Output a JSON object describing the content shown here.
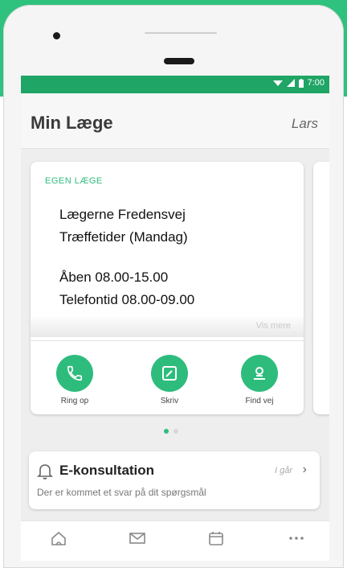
{
  "status_bar": {
    "time": "7:00"
  },
  "header": {
    "title": "Min Læge",
    "user": "Lars"
  },
  "doctor_card": {
    "label": "EGEN LÆGE",
    "clinic": "Lægerne Fredensvej",
    "hours_title": "Træffetider (Mandag)",
    "open_hours": "Åben 08.00-15.00",
    "phone_hours": "Telefontid 08.00-09.00",
    "see_more": "Vis mere",
    "actions": [
      {
        "label": "Ring op",
        "icon": "phone-icon"
      },
      {
        "label": "Skriv",
        "icon": "edit-icon"
      },
      {
        "label": "Find vej",
        "icon": "location-icon"
      }
    ]
  },
  "pager": {
    "pages": 2,
    "active": 1
  },
  "econsultation": {
    "title": "E-konsultation",
    "meta": "I går",
    "subtitle": "Der er kommet et svar på dit spørgsmål"
  },
  "bottom_nav": [
    "home-icon",
    "mail-icon",
    "calendar-icon",
    "more-icon"
  ],
  "colors": {
    "brand": "#2ebc7d",
    "statusbar": "#1fa566"
  }
}
